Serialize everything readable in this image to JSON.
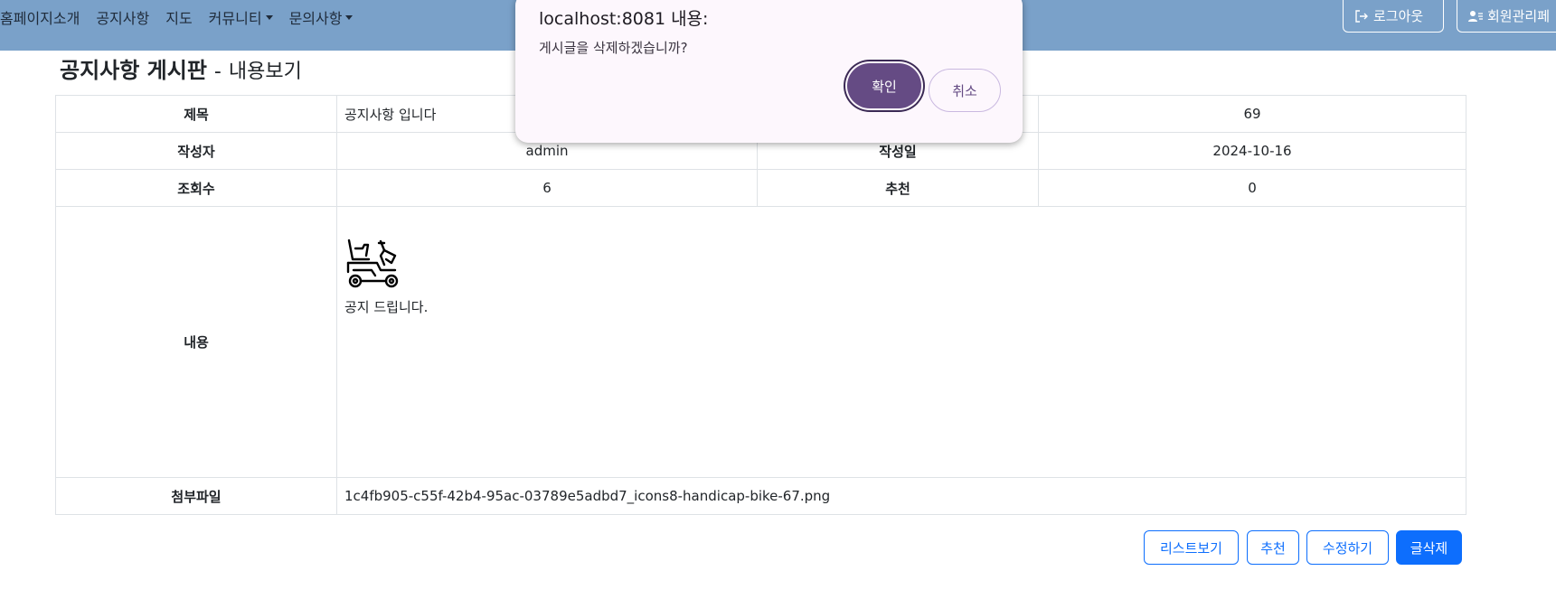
{
  "nav": {
    "items": [
      {
        "label": "홈페이지소개",
        "dropdown": false
      },
      {
        "label": "공지사항",
        "dropdown": false
      },
      {
        "label": "지도",
        "dropdown": false
      },
      {
        "label": "커뮤니티",
        "dropdown": true
      },
      {
        "label": "문의사항",
        "dropdown": true
      }
    ],
    "logout_label": "로그아웃",
    "member_label": "회원관리페"
  },
  "page": {
    "title": "공지사항 게시판",
    "separator": "-",
    "subtitle": "내용보기"
  },
  "post": {
    "labels": {
      "title": "제목",
      "author": "작성자",
      "created": "작성일",
      "views": "조회수",
      "recommend": "추천",
      "content": "내용",
      "attachment": "첨부파일"
    },
    "title": "공지사항 입니다",
    "number": "69",
    "author": "admin",
    "created": "2024-10-16",
    "views": "6",
    "recommend": "0",
    "content_text": "공지 드립니다.",
    "content_image_icon": "handicap-bike-icon",
    "attachment": "1c4fb905-c55f-42b4-95ac-03789e5adbd7_icons8-handicap-bike-67.png"
  },
  "buttons": {
    "list": "리스트보기",
    "recommend": "추천",
    "edit": "수정하기",
    "delete": "글삭제"
  },
  "dialog": {
    "title": "localhost:8081 내용:",
    "message": "게시글을 삭제하겠습니까?",
    "ok": "확인",
    "cancel": "취소"
  },
  "colors": {
    "navbar": "#7aa1c9",
    "primary": "#0d6efd",
    "dialog_bg": "#fdf7fd",
    "dialog_ok": "#654b84"
  }
}
